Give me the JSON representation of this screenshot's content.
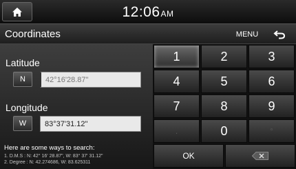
{
  "status": {
    "time": "12:06",
    "ampm": "AM"
  },
  "header": {
    "title": "Coordinates",
    "menu_label": "MENU"
  },
  "latitude": {
    "label": "Latitude",
    "dir": "N",
    "value": "42°16'28.87\""
  },
  "longitude": {
    "label": "Longitude",
    "dir": "W",
    "value": "83°37'31.12\""
  },
  "help": {
    "title": "Here are some ways to search:",
    "line1": "1. D.M.S : N: 42° 16' 28.87\", W: 83° 37' 31.12\"",
    "line2": "2. Degree : N: 42.274686, W: 83.625311"
  },
  "keypad": {
    "keys": [
      "1",
      "2",
      "3",
      "4",
      "5",
      "6",
      "7",
      "8",
      "9",
      ".",
      "0",
      "°"
    ],
    "ok_label": "OK"
  }
}
